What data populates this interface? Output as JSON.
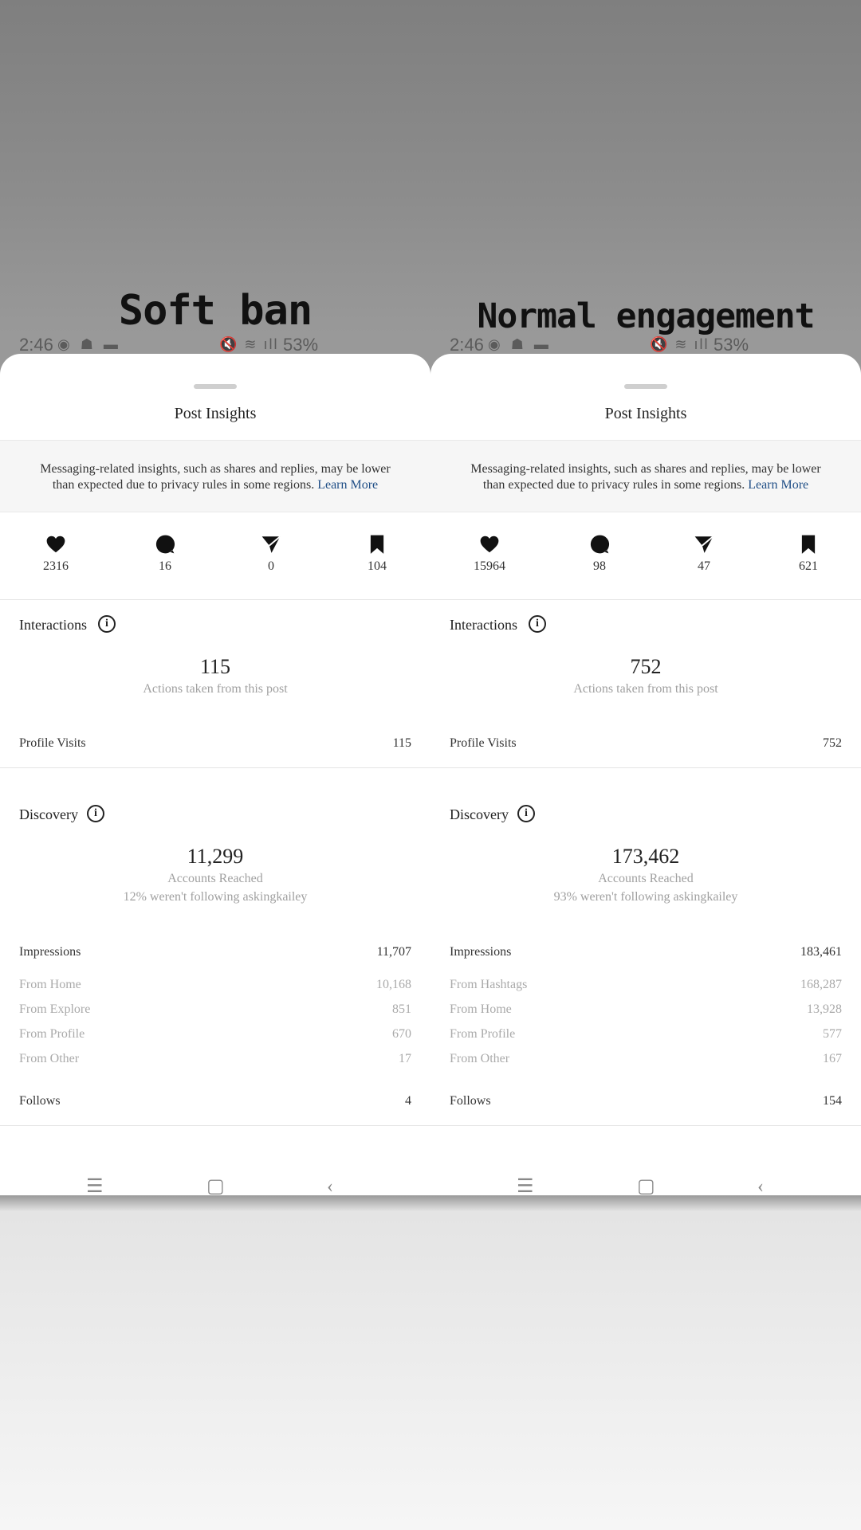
{
  "overlay": {
    "left_label": "Soft ban",
    "right_label": "Normal engagement"
  },
  "panels": [
    {
      "status": {
        "time": "2:46",
        "battery": "53%"
      },
      "title": "Post Insights",
      "notice": {
        "text": "Messaging-related insights, such as shares and replies, may be lower than expected due to privacy rules in some regions.",
        "link": "Learn More"
      },
      "stats": [
        {
          "icon": "heart-icon",
          "value": "2316"
        },
        {
          "icon": "comment-icon",
          "value": "16"
        },
        {
          "icon": "share-icon",
          "value": "0"
        },
        {
          "icon": "bookmark-icon",
          "value": "104"
        }
      ],
      "interactions": {
        "label": "Interactions",
        "total": "115",
        "total_caption": "Actions taken from this post",
        "profile_visits_label": "Profile Visits",
        "profile_visits": "115"
      },
      "discovery": {
        "label": "Discovery",
        "reach": "11,299",
        "reach_caption": "Accounts Reached",
        "reach_note": "12% weren't following askingkailey",
        "impressions_label": "Impressions",
        "impressions": "11,707",
        "sources": [
          {
            "label": "From Home",
            "value": "10,168"
          },
          {
            "label": "From Explore",
            "value": "851"
          },
          {
            "label": "From Profile",
            "value": "670"
          },
          {
            "label": "From Other",
            "value": "17"
          }
        ],
        "follows_label": "Follows",
        "follows": "4"
      }
    },
    {
      "status": {
        "time": "2:46",
        "battery": "53%"
      },
      "title": "Post Insights",
      "notice": {
        "text": "Messaging-related insights, such as shares and replies, may be lower than expected due to privacy rules in some regions.",
        "link": "Learn More"
      },
      "stats": [
        {
          "icon": "heart-icon",
          "value": "15964"
        },
        {
          "icon": "comment-icon",
          "value": "98"
        },
        {
          "icon": "share-icon",
          "value": "47"
        },
        {
          "icon": "bookmark-icon",
          "value": "621"
        }
      ],
      "interactions": {
        "label": "Interactions",
        "total": "752",
        "total_caption": "Actions taken from this post",
        "profile_visits_label": "Profile Visits",
        "profile_visits": "752"
      },
      "discovery": {
        "label": "Discovery",
        "reach": "173,462",
        "reach_caption": "Accounts Reached",
        "reach_note": "93% weren't following askingkailey",
        "impressions_label": "Impressions",
        "impressions": "183,461",
        "sources": [
          {
            "label": "From Hashtags",
            "value": "168,287"
          },
          {
            "label": "From Home",
            "value": "13,928"
          },
          {
            "label": "From Profile",
            "value": "577"
          },
          {
            "label": "From Other",
            "value": "167"
          }
        ],
        "follows_label": "Follows",
        "follows": "154"
      }
    }
  ]
}
